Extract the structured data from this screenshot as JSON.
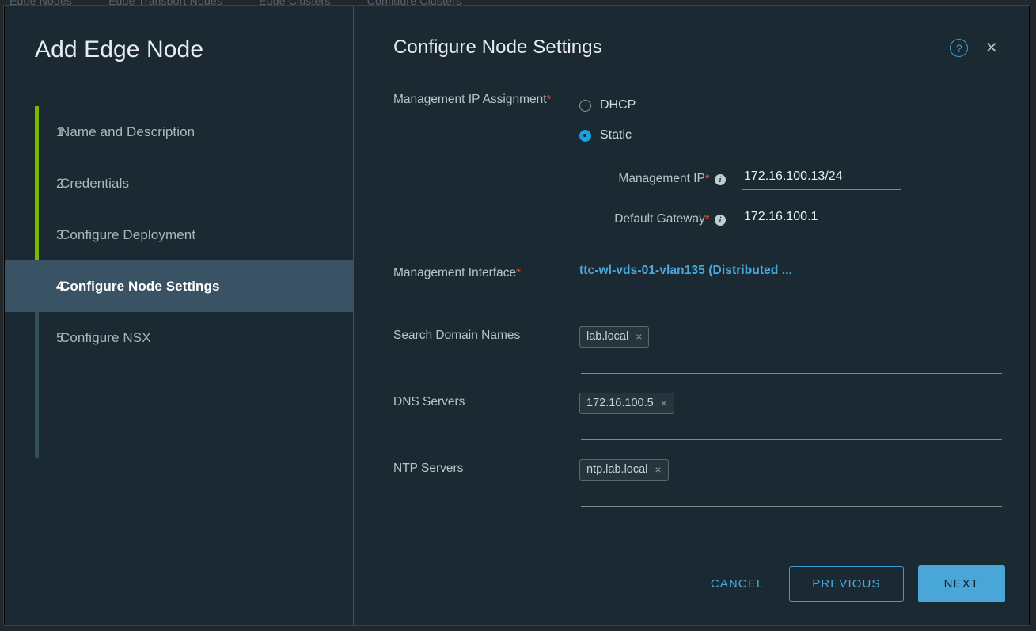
{
  "background": {
    "tabs": [
      "Edge Nodes",
      "Edge Transport Nodes",
      "Edge Clusters",
      "Configure Clusters"
    ]
  },
  "wizard": {
    "title": "Add Edge Node",
    "steps": [
      {
        "num": "1",
        "label": "Name and Description",
        "active": false
      },
      {
        "num": "2",
        "label": "Credentials",
        "active": false
      },
      {
        "num": "3",
        "label": "Configure Deployment",
        "active": false
      },
      {
        "num": "4",
        "label": "Configure Node Settings",
        "active": true
      },
      {
        "num": "5",
        "label": "Configure NSX",
        "active": false
      }
    ],
    "rail_color_complete": "#7ab800",
    "rail_color_pending": "#31505f",
    "active_row_color": "#3a5364"
  },
  "panel": {
    "title": "Configure Node Settings",
    "help_icon": "help-circle-icon",
    "help_glyph": "?",
    "close_icon": "close-icon",
    "close_glyph": "×",
    "accent_color": "#4aa8dd"
  },
  "form": {
    "ip_assignment": {
      "label": "Management IP Assignment",
      "required_marker": "*",
      "options": [
        {
          "label": "DHCP",
          "selected": false
        },
        {
          "label": "Static",
          "selected": true
        }
      ],
      "fields": [
        {
          "label": "Management IP",
          "required_marker": "*",
          "info_icon": "info-icon",
          "info_glyph": "i",
          "value": "172.16.100.13/24",
          "placeholder": ""
        },
        {
          "label": "Default Gateway",
          "required_marker": "*",
          "info_icon": "info-icon",
          "info_glyph": "i",
          "value": "172.16.100.1",
          "placeholder": ""
        }
      ]
    },
    "management_interface": {
      "label": "Management Interface",
      "required_marker": "*",
      "value": "ttc-wl-vds-01-vlan135 (Distributed ..."
    },
    "search_domain_names": {
      "label": "Search Domain Names",
      "chips": [
        "lab.local"
      ],
      "chip_remove_glyph": "×"
    },
    "dns_servers": {
      "label": "DNS Servers",
      "chips": [
        "172.16.100.5"
      ],
      "chip_remove_glyph": "×"
    },
    "ntp_servers": {
      "label": "NTP Servers",
      "chips": [
        "ntp.lab.local"
      ],
      "chip_remove_glyph": "×"
    }
  },
  "footer": {
    "cancel_label": "CANCEL",
    "previous_label": "PREVIOUS",
    "next_label": "NEXT"
  }
}
